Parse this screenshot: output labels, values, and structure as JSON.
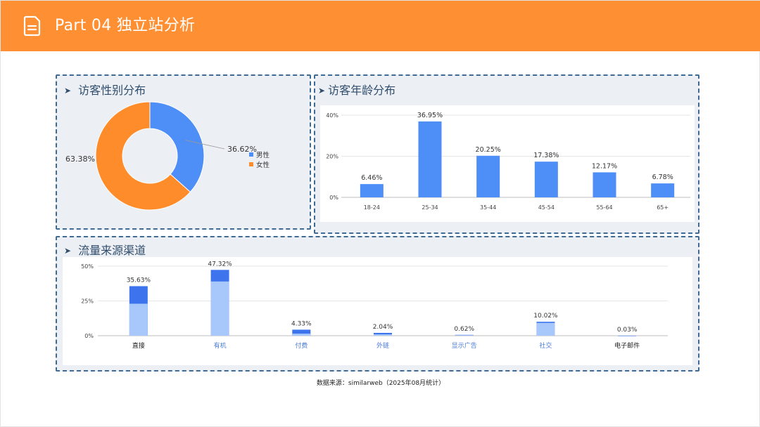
{
  "header": {
    "title": "Part 04 独立站分析",
    "icon": "document-icon",
    "background": "#ff8f33"
  },
  "gender_panel": {
    "title": "访客性别分布"
  },
  "age_panel": {
    "title": "访客年龄分布"
  },
  "traffic_panel": {
    "title": "流量来源渠道"
  },
  "footer": {
    "source": "数据来源：similarweb（2025年08月统计）"
  },
  "colors": {
    "blue": "#4e8ef7",
    "dark_blue": "#3d74ee",
    "light_blue": "#a8c7fa",
    "orange": "#ff8c2a",
    "panel_border": "#3e6a94"
  },
  "chart_data": [
    {
      "type": "pie",
      "name": "gender",
      "categories": [
        "男性",
        "女性"
      ],
      "values": [
        36.62,
        63.38
      ],
      "labels": [
        "36.62%",
        "63.38%"
      ],
      "colors": [
        "#4e8ef7",
        "#ff8c2a"
      ],
      "legend": "right"
    },
    {
      "type": "bar",
      "name": "age",
      "categories": [
        "18-24",
        "25-34",
        "35-44",
        "45-54",
        "55-64",
        "65+"
      ],
      "values": [
        6.46,
        36.95,
        20.25,
        17.38,
        12.17,
        6.78
      ],
      "labels": [
        "6.46%",
        "36.95%",
        "20.25%",
        "17.38%",
        "12.17%",
        "6.78%"
      ],
      "yticks": [
        "40%",
        "20%",
        "0%"
      ],
      "ylim": [
        0,
        40
      ],
      "grid": true
    },
    {
      "type": "bar",
      "name": "traffic",
      "stacked": true,
      "categories": [
        "直接",
        "有机",
        "付费",
        "外链",
        "显示广告",
        "社交",
        "电子邮件"
      ],
      "values": [
        35.63,
        47.32,
        4.33,
        2.04,
        0.62,
        10.02,
        0.03
      ],
      "labels": [
        "35.63%",
        "47.32%",
        "4.33%",
        "2.04%",
        "0.62%",
        "10.02%",
        "0.03%"
      ],
      "lower_segment": [
        23,
        39,
        1.5,
        1,
        0.4,
        9.2,
        0.02
      ],
      "yticks": [
        "50%",
        "25%",
        "0%"
      ],
      "ylim": [
        0,
        50
      ],
      "grid": true
    }
  ]
}
